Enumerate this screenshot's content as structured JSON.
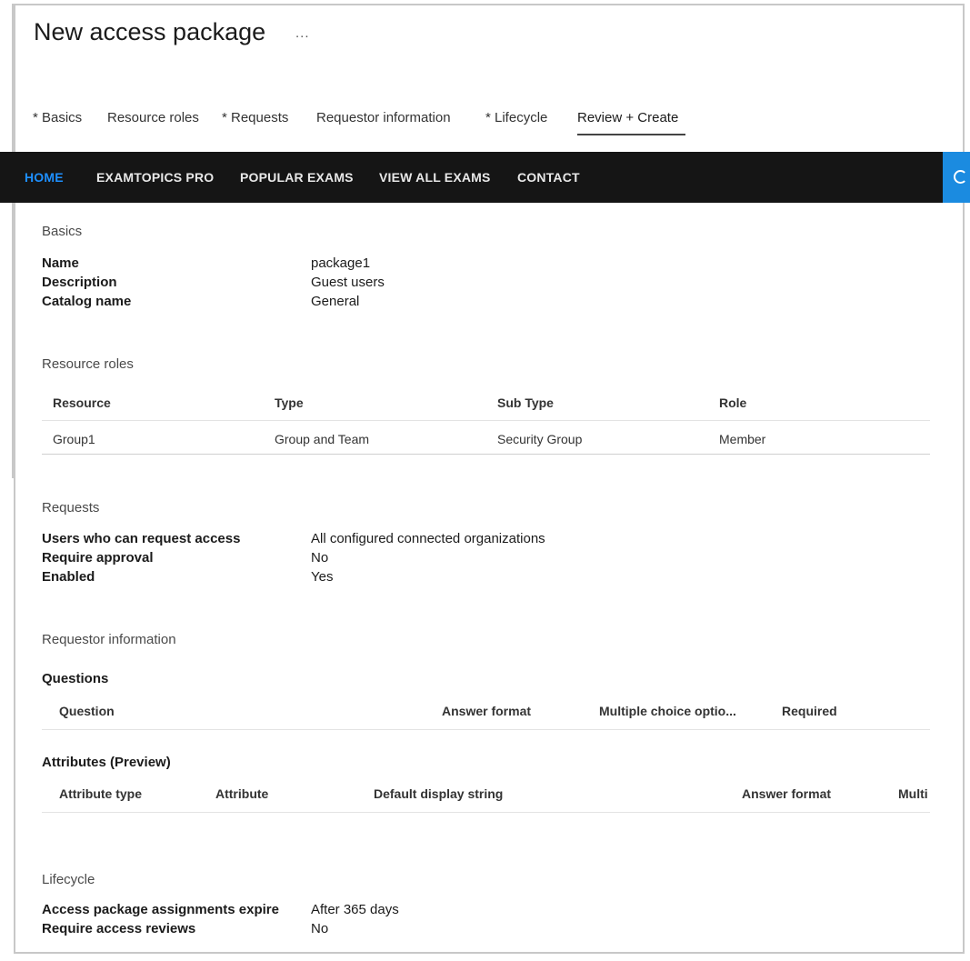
{
  "header": {
    "title": "New access package",
    "more": "..."
  },
  "tabs": [
    {
      "label": "* Basics"
    },
    {
      "label": "Resource roles"
    },
    {
      "label": "* Requests"
    },
    {
      "label": "Requestor information"
    },
    {
      "label": "* Lifecycle"
    },
    {
      "label": "Review + Create"
    }
  ],
  "navbar": {
    "items": [
      {
        "label": "HOME"
      },
      {
        "label": "EXAMTOPICS PRO"
      },
      {
        "label": "POPULAR EXAMS"
      },
      {
        "label": "VIEW ALL EXAMS"
      },
      {
        "label": "CONTACT"
      }
    ],
    "search_icon": "search-icon"
  },
  "basics": {
    "heading": "Basics",
    "rows": [
      {
        "label": "Name",
        "value": "package1"
      },
      {
        "label": "Description",
        "value": "Guest users"
      },
      {
        "label": "Catalog name",
        "value": "General"
      }
    ]
  },
  "resource_roles": {
    "heading": "Resource roles",
    "columns": [
      "Resource",
      "Type",
      "Sub Type",
      "Role"
    ],
    "rows": [
      [
        "Group1",
        "Group and Team",
        "Security Group",
        "Member"
      ]
    ]
  },
  "requests": {
    "heading": "Requests",
    "rows": [
      {
        "label": "Users who can request access",
        "value": "All configured connected organizations"
      },
      {
        "label": "Require approval",
        "value": "No"
      },
      {
        "label": "Enabled",
        "value": "Yes"
      }
    ]
  },
  "requestor_information": {
    "heading": "Requestor information",
    "questions_heading": "Questions",
    "question_columns": [
      "Question",
      "Answer format",
      "Multiple choice optio...",
      "Required"
    ],
    "attributes_heading": "Attributes (Preview)",
    "attribute_columns": [
      "Attribute type",
      "Attribute",
      "Default display string",
      "Answer format",
      "Multi"
    ]
  },
  "lifecycle": {
    "heading": "Lifecycle",
    "rows": [
      {
        "label": "Access package assignments expire",
        "value": "After 365 days"
      },
      {
        "label": "Require access reviews",
        "value": "No"
      }
    ]
  }
}
